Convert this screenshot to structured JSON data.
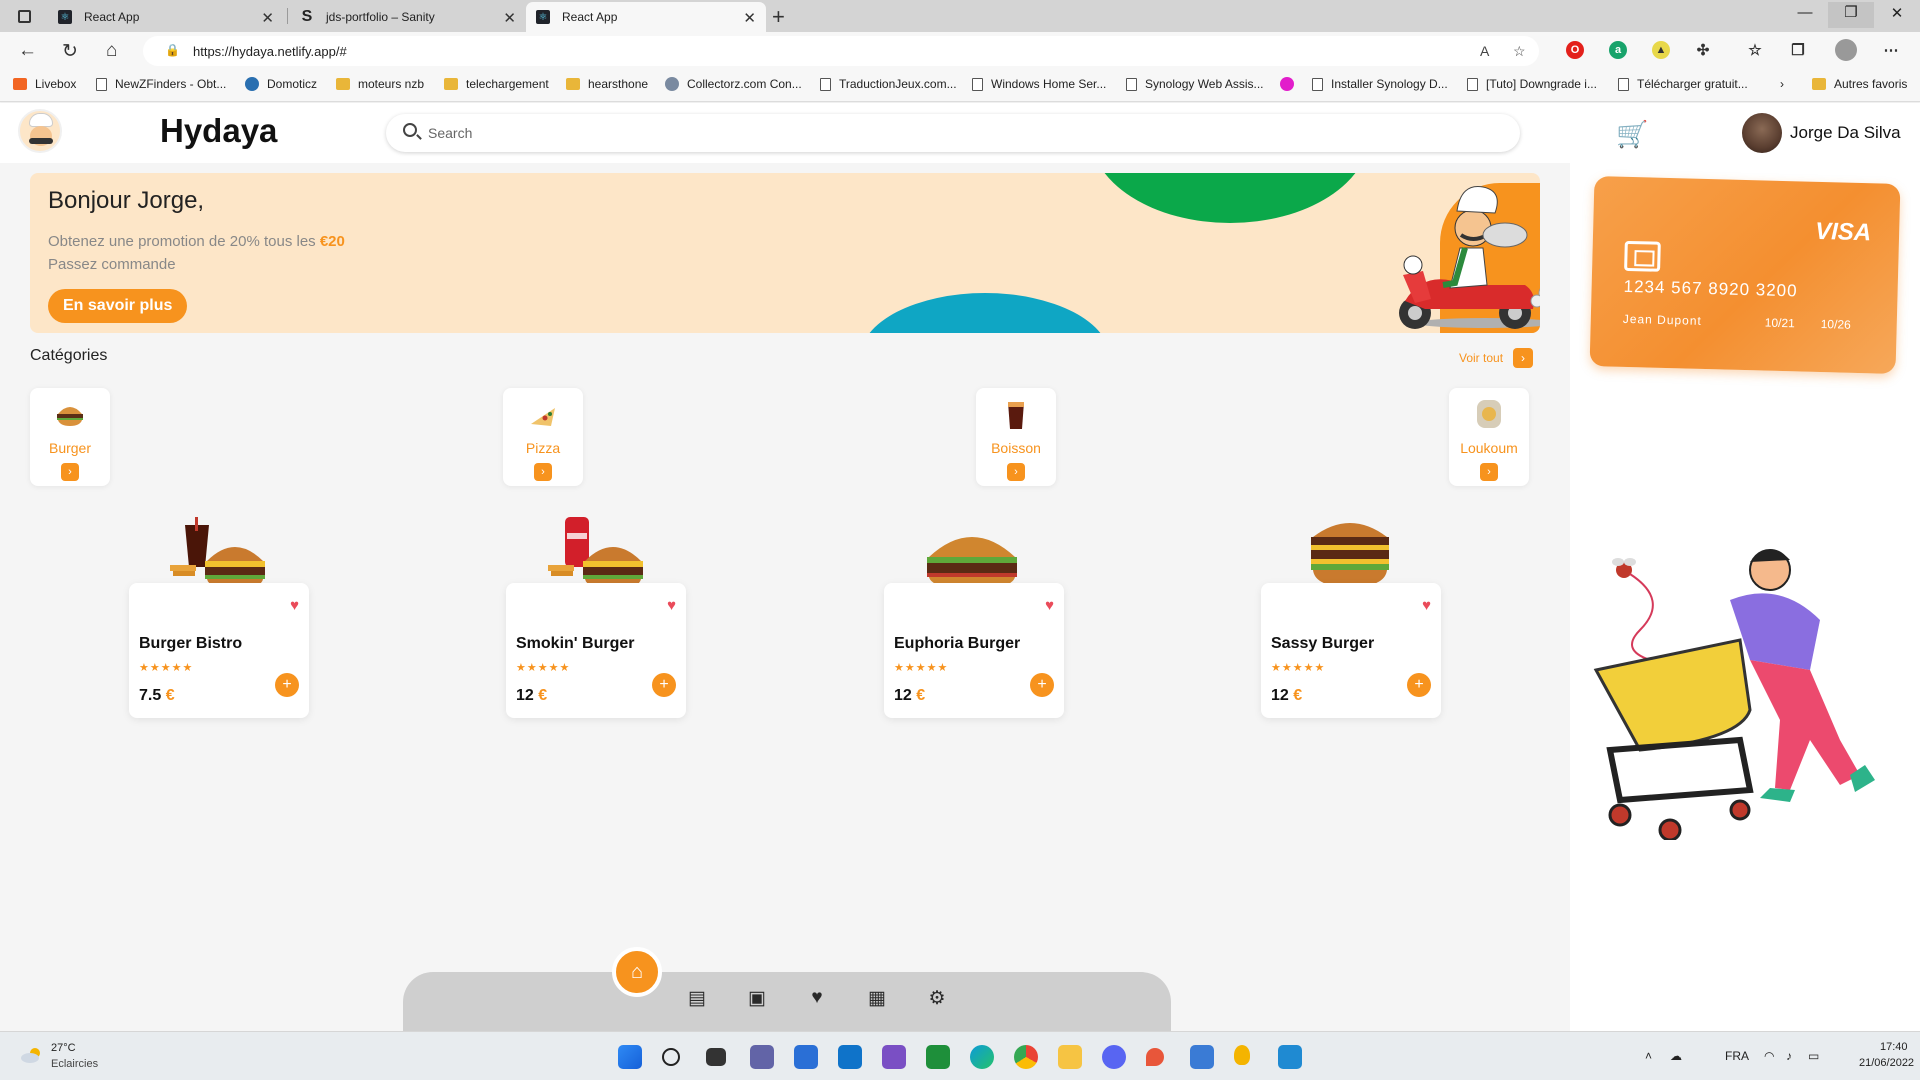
{
  "browser": {
    "tabs": [
      {
        "title": "React App",
        "active": false
      },
      {
        "title": "jds-portfolio – Sanity",
        "active": false
      },
      {
        "title": "React App",
        "active": true
      }
    ],
    "url": "https://hydaya.netlify.app/#",
    "bookmarks": [
      "Livebox",
      "NewZFinders - Obt...",
      "Domoticz",
      "moteurs nzb",
      "telechargement",
      "hearsthone",
      "Collectorz.com Con...",
      "TraductionJeux.com...",
      "Windows Home Ser...",
      "Synology Web Assis...",
      "Installer Synology D...",
      "[Tuto] Downgrade i...",
      "Télécharger gratuit...",
      "Autres favoris"
    ]
  },
  "header": {
    "brand": "Hydaya",
    "search_placeholder": "Search",
    "user_name": "Jorge Da Silva"
  },
  "promo": {
    "greeting": "Bonjour Jorge,",
    "line1": "Obtenez une promotion de 20% tous les ",
    "line1_amount": "€20",
    "line2": "Passez commande",
    "cta": "En savoir plus"
  },
  "categories": {
    "title": "Catégories",
    "see_all": "Voir tout",
    "items": [
      {
        "label": "Burger"
      },
      {
        "label": "Pizza"
      },
      {
        "label": "Boisson"
      },
      {
        "label": "Loukoum"
      }
    ]
  },
  "products": [
    {
      "name": "Burger Bistro",
      "price": "7.5",
      "currency": "€",
      "rating": 5
    },
    {
      "name": "Smokin' Burger",
      "price": "12",
      "currency": "€",
      "rating": 5
    },
    {
      "name": "Euphoria Burger",
      "price": "12",
      "currency": "€",
      "rating": 5
    },
    {
      "name": "Sassy Burger",
      "price": "12",
      "currency": "€",
      "rating": 5
    }
  ],
  "card": {
    "brand": "VISA",
    "number": "1234 567 8920 3200",
    "holder": "Jean Dupont",
    "date1": "10/21",
    "date2": "10/26"
  },
  "taskbar": {
    "temperature": "27°C",
    "weather": "Eclaircies",
    "lang": "FRA",
    "time": "17:40",
    "date": "21/06/2022"
  },
  "colors": {
    "accent": "#f7931e",
    "heart": "#ea4b5a",
    "green": "#0ba84a",
    "blue": "#0fa6c4"
  }
}
